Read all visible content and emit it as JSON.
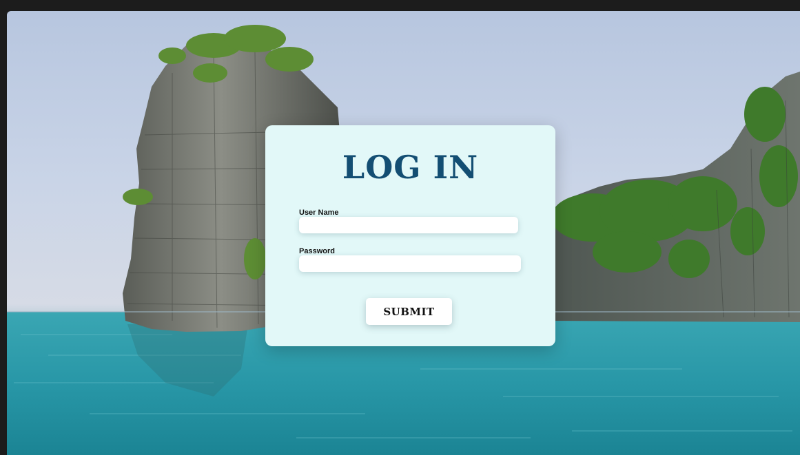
{
  "login": {
    "title": "LOG IN",
    "username_label": "User Name",
    "username_value": "",
    "password_label": "Password",
    "password_value": "",
    "submit_label": "SUBMIT"
  },
  "colors": {
    "title": "#134e73",
    "card_background": "#e2f8f8",
    "sea": "#2b94a5",
    "sky": "#c9d4e7"
  }
}
